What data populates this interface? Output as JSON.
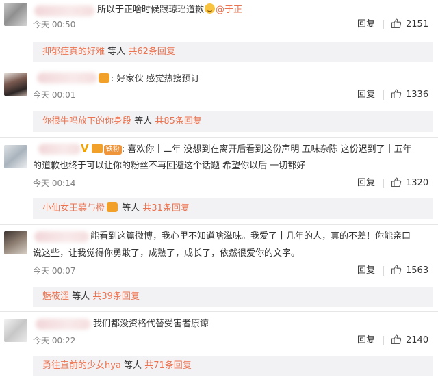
{
  "comments": [
    {
      "text": "所以于正啥时候跟琼瑶道歉",
      "mention": "@于正",
      "time": "今天 00:50",
      "reply_label": "回复",
      "likes": "2151",
      "sub": {
        "name": "抑郁症真的好难",
        "mid": "等人",
        "count": "共62条回复"
      }
    },
    {
      "text": "好家伙 感觉热搜预订",
      "time": "今天 00:01",
      "reply_label": "回复",
      "likes": "1336",
      "sub": {
        "name": "你很牛吗放下的你身段",
        "mid": "等人",
        "count": "共85条回复"
      }
    },
    {
      "badge": "铁粉",
      "line1": "喜欢你十二年 没想到在离开后看到这份声明 五味杂陈 这份迟到了十五年",
      "line2": "的道歉也终于可以让你的粉丝不再回避这个话题 希望你以后 一切都好",
      "time": "今天 00:14",
      "reply_label": "回复",
      "likes": "1320",
      "sub": {
        "name": "小仙女王慕与橙",
        "mid": "等人",
        "count": "共31条回复"
      }
    },
    {
      "line1": "能看到这篇微博，我心里不知道啥滋味。我爱了十几年的人，真的不差！你能亲口",
      "line2": "说这些，让我觉得你勇敢了，成熟了，成长了，依然很爱你的文字。",
      "time": "今天 00:07",
      "reply_label": "回复",
      "likes": "1563",
      "sub": {
        "name": "魅筱涩",
        "mid": "等人",
        "count": "共39条回复"
      }
    },
    {
      "text": "我们都没资格代替受害者原谅",
      "time": "今天 00:22",
      "reply_label": "回复",
      "likes": "2140",
      "sub": {
        "name": "勇往直前的少女hya",
        "mid": "等人",
        "count": "共71条回复"
      }
    }
  ],
  "colors": {
    "accent": "#eb7350",
    "text": "#333333",
    "muted": "#808080",
    "sub_bg": "#f2f2f5"
  },
  "icons": {
    "like": "thumbs-up-icon",
    "emoji": "grinning-face-icon",
    "vip": "crown-icon",
    "verified": "verified-v-icon"
  }
}
